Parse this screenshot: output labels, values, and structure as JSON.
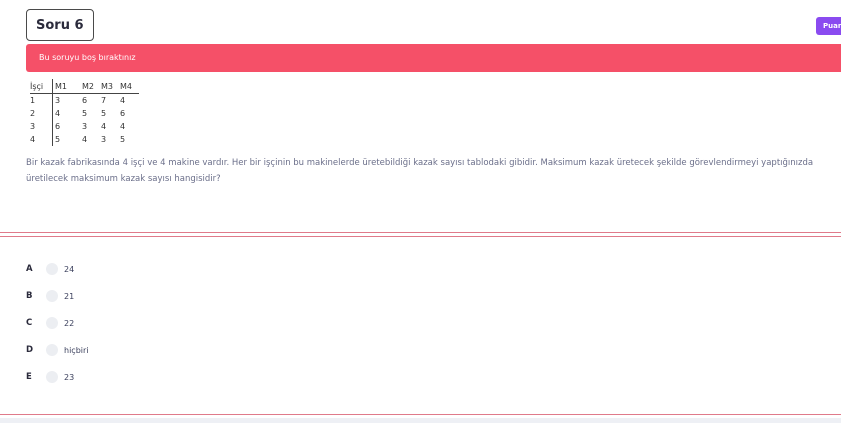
{
  "question": {
    "title": "Soru 6",
    "score_label": "Puan",
    "alert": "Bu soruyu boş bıraktınız",
    "table": {
      "headers": [
        "İşçi",
        "M1",
        "M2",
        "M3",
        "M4"
      ],
      "rows": [
        [
          "1",
          "3",
          "6",
          "7",
          "4"
        ],
        [
          "2",
          "4",
          "5",
          "5",
          "6"
        ],
        [
          "3",
          "6",
          "3",
          "4",
          "4"
        ],
        [
          "4",
          "5",
          "4",
          "3",
          "5"
        ]
      ]
    },
    "text": "Bir kazak fabrikasında 4 işçi ve 4 makine vardır. Her bir işçinin bu makinelerde üretebildiği kazak sayısı tablodaki gibidir. Maksimum kazak üretecek şekilde görevlendirmeyi yaptığınızda üretilecek maksimum kazak sayısı hangisidir?"
  },
  "options": [
    {
      "letter": "A",
      "text": "24"
    },
    {
      "letter": "B",
      "text": "21"
    },
    {
      "letter": "C",
      "text": "22"
    },
    {
      "letter": "D",
      "text": "hiçbiri"
    },
    {
      "letter": "E",
      "text": "23"
    }
  ]
}
